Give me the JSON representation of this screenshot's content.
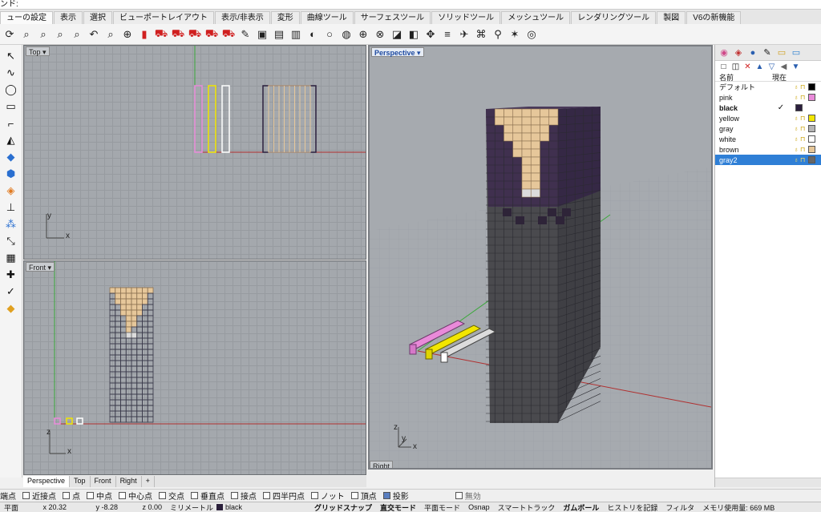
{
  "command_prompt": "ンド:",
  "menu_tabs": [
    "ューの設定",
    "表示",
    "選択",
    "ビューポートレイアウト",
    "表示/非表示",
    "変形",
    "曲線ツール",
    "サーフェスツール",
    "ソリッドツール",
    "メッシュツール",
    "レンダリングツール",
    "製図",
    "V6の新機能"
  ],
  "toolbar_icons": [
    "rotate-icon",
    "zoom-icon",
    "zoom-window-icon",
    "zoom-extents-icon",
    "zoom-selected-icon",
    "undo-view-icon",
    "zoom-out-icon",
    "zoom-target-icon",
    "red-car-icon",
    "car1-icon",
    "car2-icon",
    "car3-icon",
    "car4-icon",
    "car5-icon",
    "pencil-icon",
    "camera-icon",
    "cplane-icon",
    "print-icon",
    "render-icon",
    "sphere-icon",
    "globe-icon",
    "target-icon",
    "crosshair-icon",
    "palette-icon",
    "box-icon",
    "gumball-icon",
    "align-icon",
    "plane-icon",
    "mesh-icon",
    "walk-icon",
    "sparkle-icon",
    "compass-icon"
  ],
  "left_tools": [
    "arrow-icon",
    "curve-icon",
    "circle-icon",
    "rect-icon",
    "polyline-icon",
    "extrude-icon",
    "surface-icon",
    "solid-icon",
    "mesh-icon",
    "dimension-icon",
    "points-icon",
    "transform-icon",
    "array-icon",
    "analyze-icon",
    "check-icon",
    "render-icon"
  ],
  "viewports": {
    "top": {
      "label": "Top",
      "axis_y": "y",
      "axis_x": "x"
    },
    "front": {
      "label": "Front",
      "axis_z": "z",
      "axis_x": "x"
    },
    "perspective": {
      "label": "Perspective",
      "axis_z": "z",
      "axis_y": "y",
      "axis_x": "x",
      "bottom_label": "Right"
    }
  },
  "viewport_tabs": [
    "Perspective",
    "Top",
    "Front",
    "Right"
  ],
  "layer_panel": {
    "header_name": "名前",
    "header_current": "現在",
    "layers": [
      {
        "name": "デフォルト",
        "color": "#000000",
        "current": false,
        "selected": false,
        "bold": false
      },
      {
        "name": "pink",
        "color": "#e98ad9",
        "current": false,
        "selected": false,
        "bold": false
      },
      {
        "name": "black",
        "color": "#2b1f3d",
        "current": true,
        "selected": false,
        "bold": true
      },
      {
        "name": "yellow",
        "color": "#f2e600",
        "current": false,
        "selected": false,
        "bold": false
      },
      {
        "name": "gray",
        "color": "#b4b4b4",
        "current": false,
        "selected": false,
        "bold": false
      },
      {
        "name": "white",
        "color": "#ffffff",
        "current": false,
        "selected": false,
        "bold": false
      },
      {
        "name": "brown",
        "color": "#e6c79a",
        "current": false,
        "selected": false,
        "bold": false
      },
      {
        "name": "gray2",
        "color": "#666666",
        "current": false,
        "selected": true,
        "bold": false
      }
    ],
    "current_mark": "✓"
  },
  "osnap": [
    {
      "label": "端点",
      "checked": false
    },
    {
      "label": "近接点",
      "checked": false
    },
    {
      "label": "点",
      "checked": false
    },
    {
      "label": "中点",
      "checked": false
    },
    {
      "label": "中心点",
      "checked": false
    },
    {
      "label": "交点",
      "checked": false
    },
    {
      "label": "垂直点",
      "checked": false
    },
    {
      "label": "接点",
      "checked": false
    },
    {
      "label": "四半円点",
      "checked": false
    },
    {
      "label": "ノット",
      "checked": false
    },
    {
      "label": "頂点",
      "checked": false
    },
    {
      "label": "投影",
      "checked": true
    },
    {
      "label": "無効",
      "checked": false
    }
  ],
  "status": {
    "cplane": "平面",
    "x": "x 20.32",
    "y": "y -8.28",
    "z": "z 0.00",
    "units": "ミリメートル",
    "layer": "black",
    "grid_snap": "グリッドスナップ",
    "ortho": "直交モード",
    "planar": "平面モード",
    "osnap": "Osnap",
    "smart_track": "スマートトラック",
    "gumball": "ガムボール",
    "history": "ヒストリを記録",
    "filter": "フィルタ",
    "memory": "メモリ使用量: 669 MB"
  },
  "colors": {
    "pink": "#e98ad9",
    "yellow": "#f2e600",
    "white": "#ffffff",
    "black": "#2b1f3d",
    "brown": "#e6c79a",
    "gray": "#b4b4b4",
    "gray2": "#5a5a5a",
    "selection": "#2f7fd6"
  }
}
